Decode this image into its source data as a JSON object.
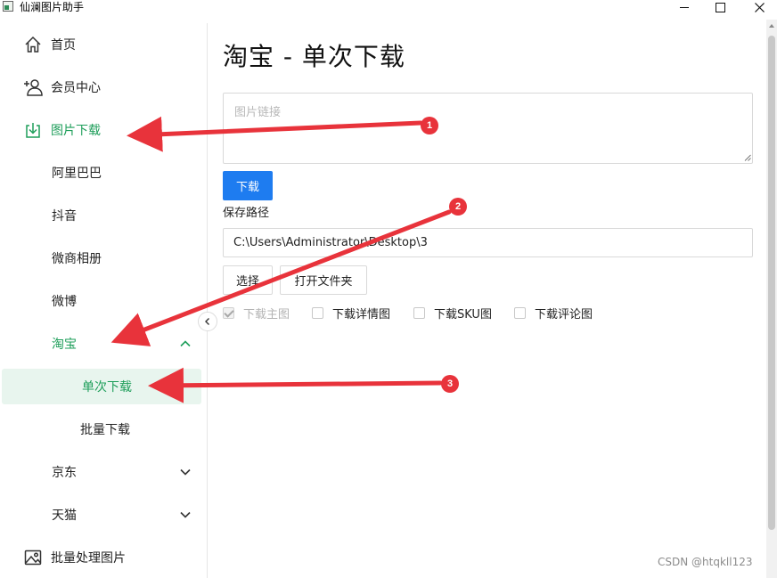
{
  "window": {
    "title": "仙澜图片助手",
    "controls": {
      "minimize": "minimize",
      "maximize": "maximize",
      "close": "close"
    }
  },
  "sidebar": {
    "items": [
      {
        "label": "首页",
        "icon": "home-icon"
      },
      {
        "label": "会员中心",
        "icon": "add-user-icon"
      },
      {
        "label": "图片下载",
        "icon": "download-icon",
        "state": "active"
      },
      {
        "label": "阿里巴巴"
      },
      {
        "label": "抖音"
      },
      {
        "label": "微商相册"
      },
      {
        "label": "微博"
      },
      {
        "label": "淘宝",
        "state": "expanded",
        "chevron": "chevron-up-icon"
      },
      {
        "label": "单次下载",
        "state": "selected"
      },
      {
        "label": "批量下载"
      },
      {
        "label": "京东",
        "chevron": "chevron-down-icon"
      },
      {
        "label": "天猫",
        "chevron": "chevron-down-icon"
      },
      {
        "label": "批量处理图片",
        "icon": "image-icon"
      }
    ]
  },
  "main": {
    "title": "淘宝 - 单次下载",
    "link_placeholder": "图片链接",
    "download_button": "下载",
    "save_path_label": "保存路径",
    "save_path_value": "C:\\Users\\Administrator\\Desktop\\3",
    "select_button": "选择",
    "open_folder_button": "打开文件夹",
    "options": [
      {
        "label": "下载主图",
        "checked": true,
        "disabled": true
      },
      {
        "label": "下载详情图",
        "checked": false
      },
      {
        "label": "下载SKU图",
        "checked": false
      },
      {
        "label": "下载评论图",
        "checked": false
      }
    ]
  },
  "annotations": {
    "badges": [
      "1",
      "2",
      "3"
    ],
    "color": "#e8333b"
  },
  "watermark": "CSDN @htqkll123",
  "colors": {
    "accent_green": "#1e9e5a",
    "selected_bg": "#e8f5ee",
    "primary_blue": "#1e7cf0"
  }
}
